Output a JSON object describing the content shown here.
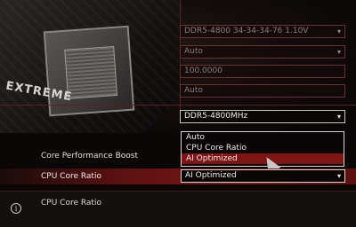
{
  "settings": {
    "dram_timing": "DDR5-4800 34-34-34-76 1.10V",
    "field2": "Auto",
    "field3": "100.0000",
    "field4": "Auto",
    "dram_frequency": "DDR5-4800MHz"
  },
  "brand": {
    "text": "EXTREME"
  },
  "rows": {
    "core_perf_boost_label": "Core Performance Boost",
    "cpu_core_ratio_label": "CPU Core Ratio",
    "cpu_core_ratio_value": "AI Optimized"
  },
  "dropdown": {
    "options": [
      "Auto",
      "CPU Core Ratio",
      "AI Optimized"
    ],
    "selected_index": 2
  },
  "help": {
    "text": "CPU Core Ratio"
  },
  "icons": {
    "arrow": "▾",
    "info": "i"
  },
  "colors": {
    "accent_red": "#7c1717",
    "border_red": "#6b3232"
  }
}
